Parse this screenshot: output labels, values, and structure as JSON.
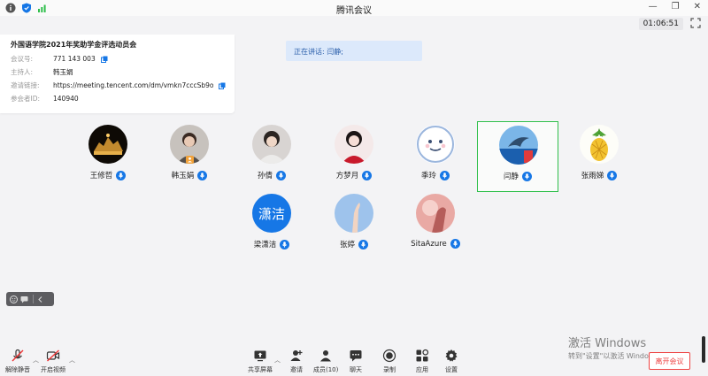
{
  "window": {
    "title": "腾讯会议",
    "timer": "01:06:51"
  },
  "meeting": {
    "title": "外国语学院2021年奖助学金评选动员会",
    "id_label": "会议号:",
    "id_value": "771 143 003",
    "host_label": "主持人:",
    "host_value": "韩玉娟",
    "link_label": "邀请链接:",
    "link_value": "https://meeting.tencent.com/dm/vmkn7cccSb9o",
    "pid_label": "参会者ID:",
    "pid_value": "140940"
  },
  "speaking": "正在讲话: 闫静;",
  "participants": [
    {
      "name": "王修哲"
    },
    {
      "name": "韩玉娟"
    },
    {
      "name": "孙倩"
    },
    {
      "name": "方梦月"
    },
    {
      "name": "季玲"
    },
    {
      "name": "闫静"
    },
    {
      "name": "张雨娣"
    },
    {
      "name": "梁潇洁",
      "avatar_text": "潇洁"
    },
    {
      "name": "张婷"
    },
    {
      "name": "SitaAzure"
    }
  ],
  "toolbar": {
    "unmute": "解除静音",
    "start_video": "开启视频",
    "share": "共享屏幕",
    "invite": "邀请",
    "members": "成员(10)",
    "chat": "聊天",
    "record": "录制",
    "apps": "应用",
    "settings": "设置"
  },
  "leave": "离开会议",
  "watermark": {
    "title": "激活 Windows",
    "subtitle": "转到\"设置\"以激活 Windows"
  },
  "colors": {
    "accent": "#1677e6",
    "active_border": "#2fbf4b",
    "leave": "#e44444"
  }
}
